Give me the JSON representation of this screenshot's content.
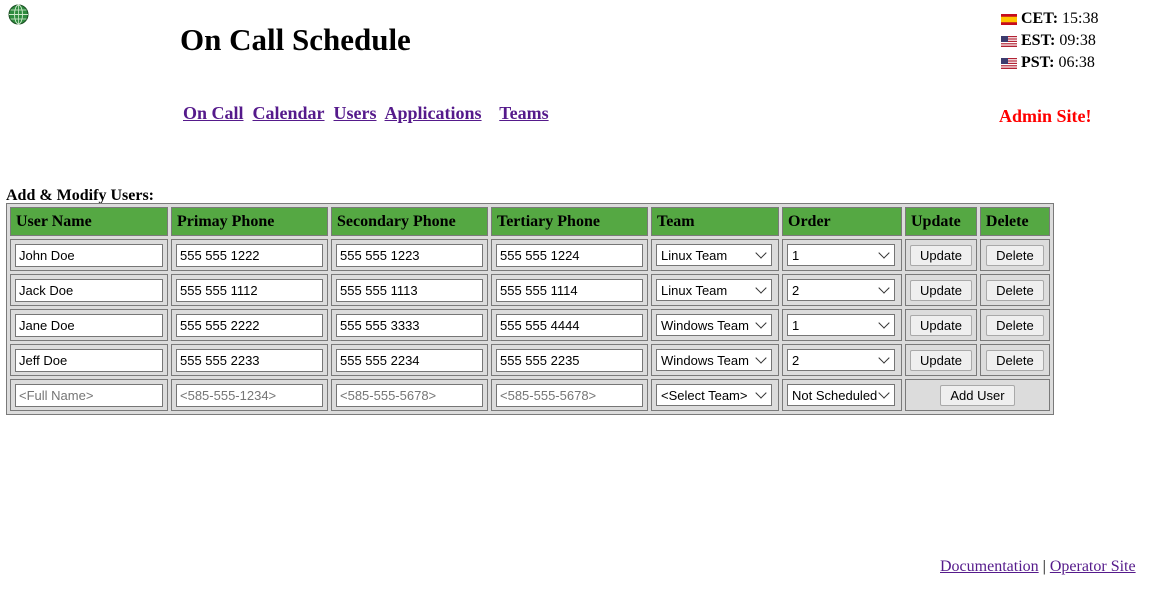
{
  "header": {
    "title": "On Call Schedule",
    "globe_icon": "globe-icon"
  },
  "clocks": [
    {
      "tz": "CET:",
      "time": "15:38",
      "flag": "spain-flag-icon"
    },
    {
      "tz": "EST:",
      "time": "09:38",
      "flag": "us-flag-icon"
    },
    {
      "tz": "PST:",
      "time": "06:38",
      "flag": "us-flag-icon"
    }
  ],
  "nav": {
    "items": [
      "On Call",
      "Calendar",
      "Users",
      "Applications",
      "Teams"
    ]
  },
  "admin_label": "Admin Site!",
  "section_label": "Add & Modify Users:",
  "table": {
    "columns": [
      "User Name",
      "Primay Phone",
      "Secondary Phone",
      "Tertiary Phone",
      "Team",
      "Order",
      "Update",
      "Delete"
    ],
    "rows": [
      {
        "name": "John Doe",
        "primary": "555 555 1222",
        "secondary": "555 555 1223",
        "tertiary": "555 555 1224",
        "team": "Linux Team",
        "order": "1",
        "update": "Update",
        "delete": "Delete"
      },
      {
        "name": "Jack Doe",
        "primary": "555 555 1112",
        "secondary": "555 555 1113",
        "tertiary": "555 555 1114",
        "team": "Linux Team",
        "order": "2",
        "update": "Update",
        "delete": "Delete"
      },
      {
        "name": "Jane Doe",
        "primary": "555 555 2222",
        "secondary": "555 555 3333",
        "tertiary": "555 555 4444",
        "team": "Windows Team",
        "order": "1",
        "update": "Update",
        "delete": "Delete"
      },
      {
        "name": "Jeff Doe",
        "primary": "555 555 2233",
        "secondary": "555 555 2234",
        "tertiary": "555 555 2235",
        "team": "Windows Team",
        "order": "2",
        "update": "Update",
        "delete": "Delete"
      }
    ],
    "new_row": {
      "name_placeholder": "<Full Name>",
      "primary_placeholder": "<585-555-1234>",
      "secondary_placeholder": "<585-555-5678>",
      "tertiary_placeholder": "<585-555-5678>",
      "team": "<Select Team>",
      "order": "Not Scheduled",
      "add_label": "Add User"
    }
  },
  "footer": {
    "documentation": "Documentation",
    "separator": "|",
    "operator": "Operator Site"
  },
  "colors": {
    "header_green": "#55a843",
    "admin_red": "#ff0000",
    "link_purple": "#551a8b",
    "table_gray": "#dcdcdc"
  }
}
